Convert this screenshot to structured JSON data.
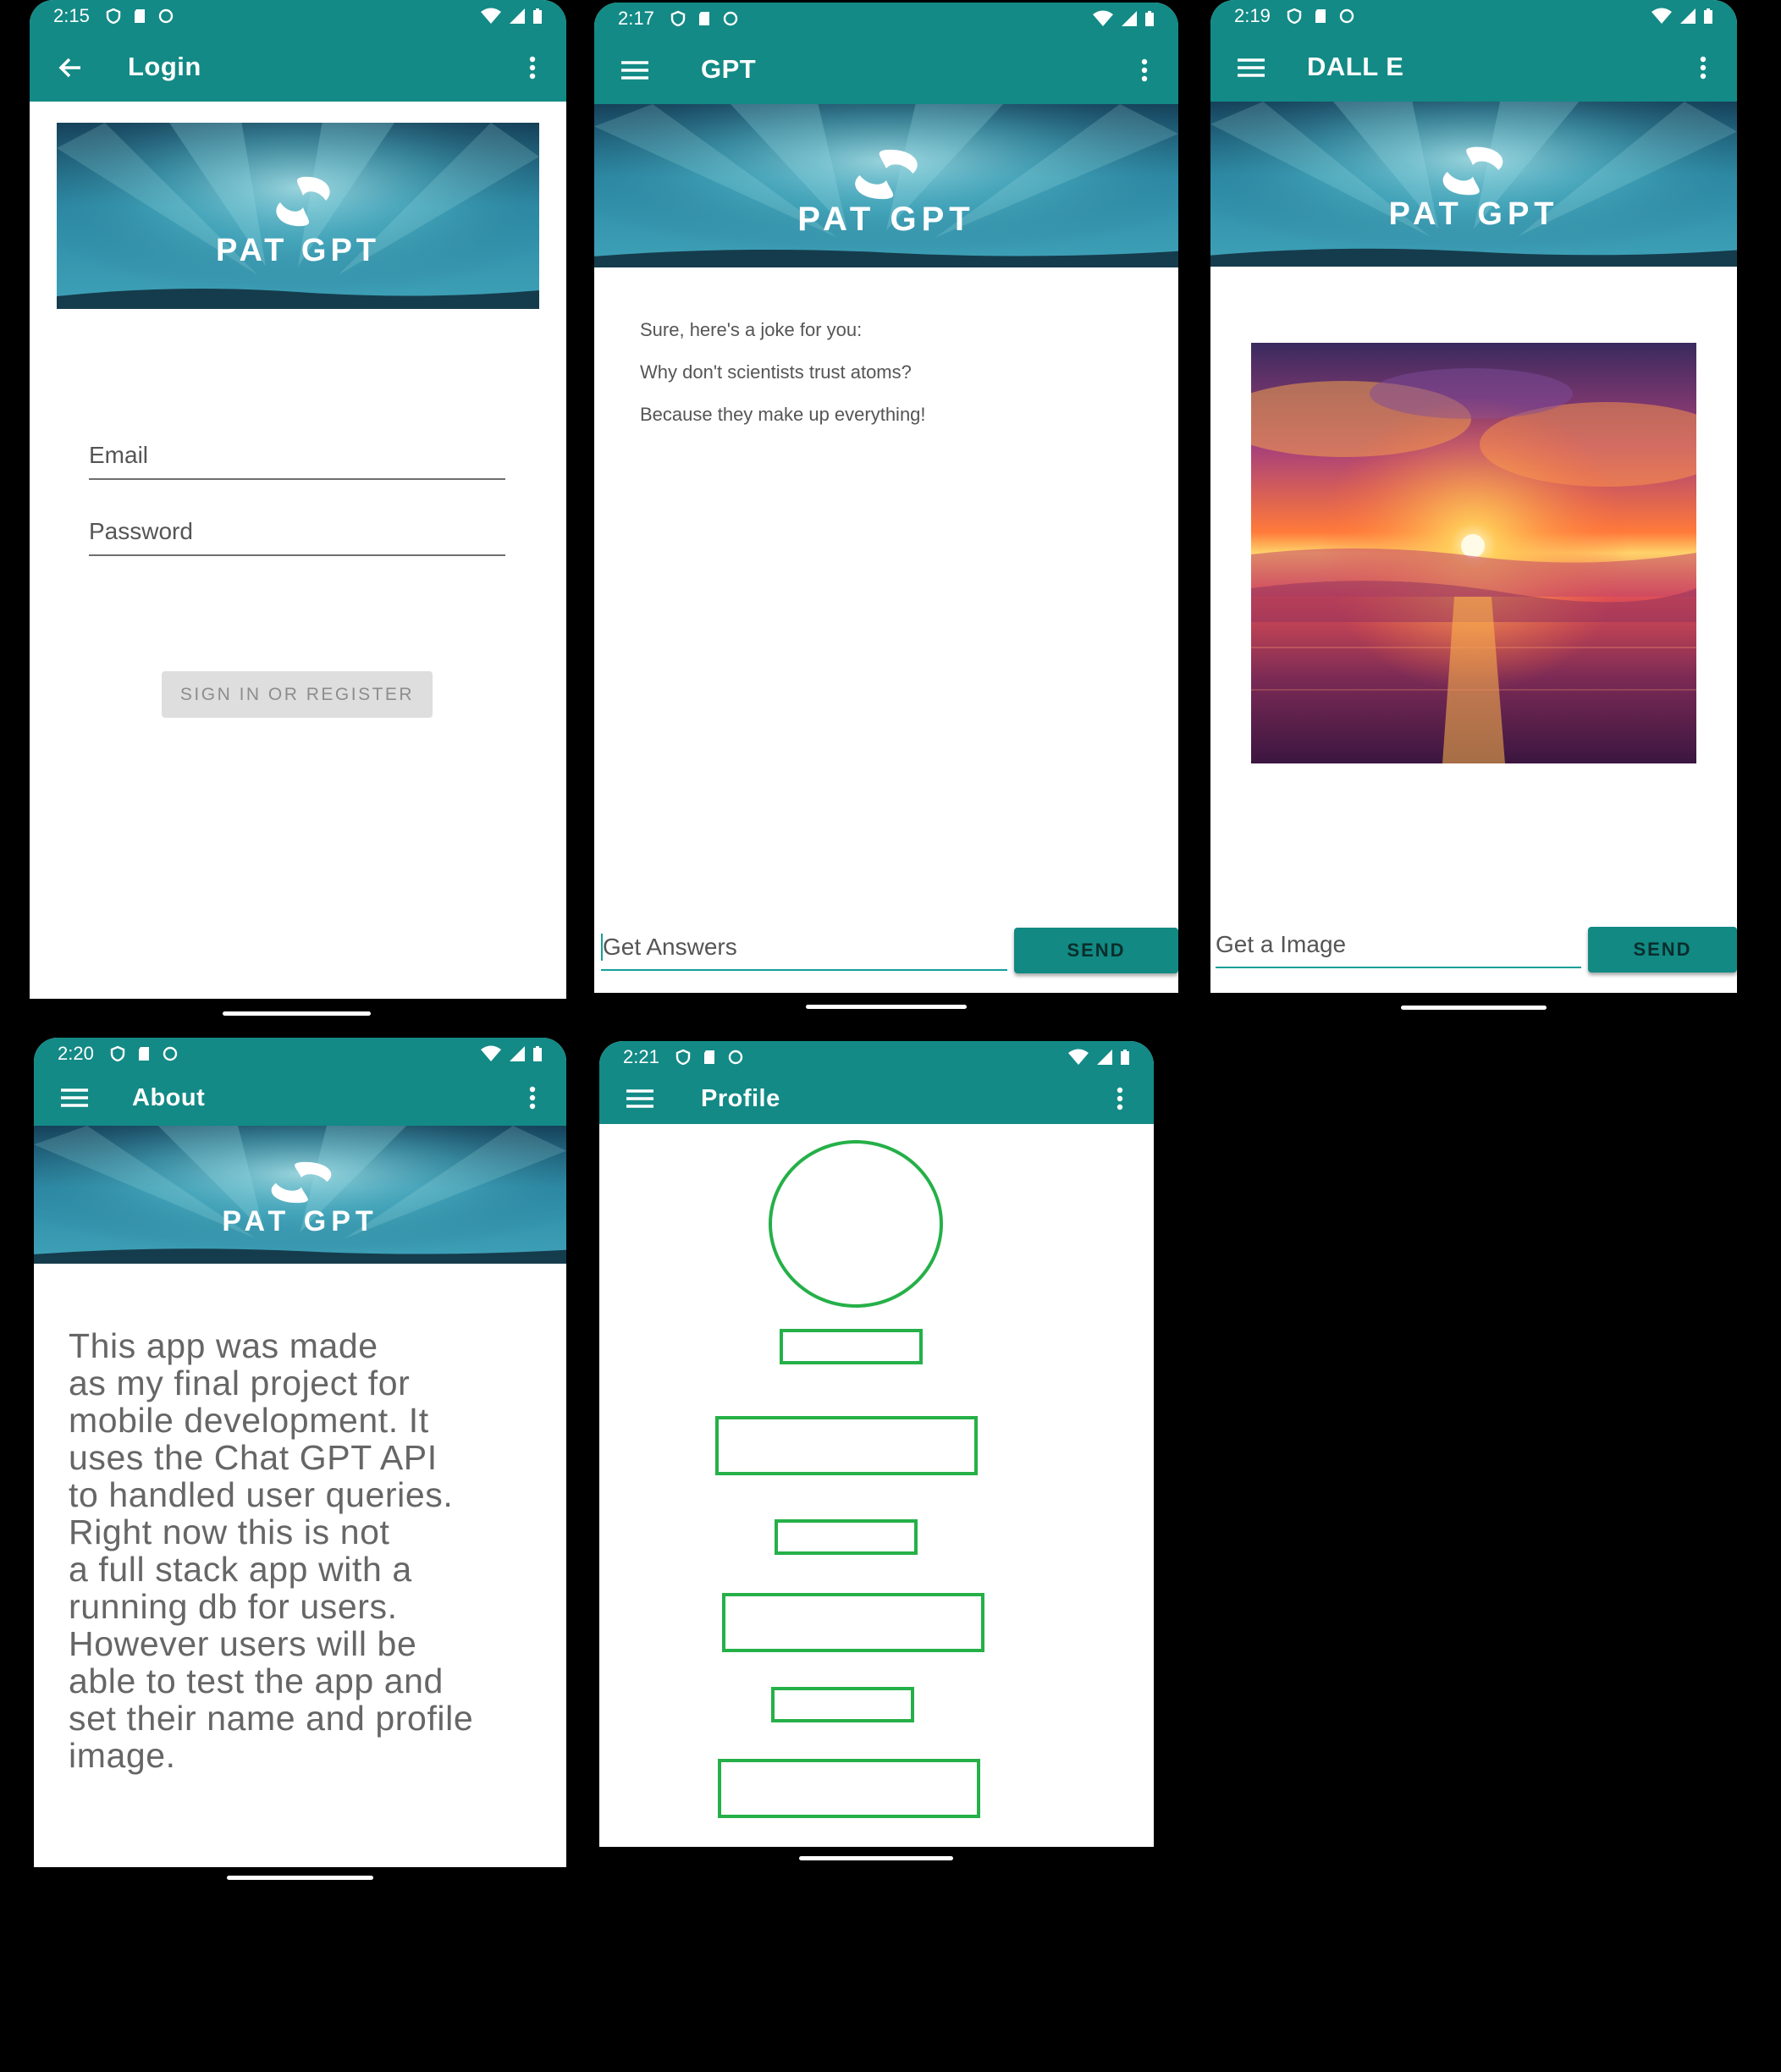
{
  "brand": {
    "logo_text": "PAT GPT",
    "primary_color": "#138a86",
    "accent_green": "#25b048"
  },
  "screens": {
    "login": {
      "status_time": "2:15",
      "title": "Login",
      "email_placeholder": "Email",
      "password_placeholder": "Password",
      "sign_in_label": "SIGN IN OR REGISTER"
    },
    "gpt": {
      "status_time": "2:17",
      "title": "GPT",
      "messages": [
        "Sure, here's a joke for you:",
        "Why don't scientists trust atoms?",
        "Because they make up everything!"
      ],
      "input_placeholder": "Get Answers",
      "send_label": "SEND"
    },
    "dalle": {
      "status_time": "2:19",
      "title": "DALL E",
      "image_subject": "sunset-over-water",
      "input_placeholder": "Get a Image",
      "send_label": "SEND"
    },
    "about": {
      "status_time": "2:20",
      "title": "About",
      "body_lines": [
        "This app was made",
        "as my final project for",
        "mobile development. It",
        "uses the Chat GPT API",
        "to handled user queries.",
        "Right now this is not",
        "a full stack app with a",
        "running db for users.",
        "However users will be",
        "able to test the app and",
        "set their name and profile",
        "image."
      ]
    },
    "profile": {
      "status_time": "2:21",
      "title": "Profile"
    }
  },
  "icons": {
    "back": "arrow-left-icon",
    "menu": "hamburger-menu-icon",
    "overflow": "more-vert-icon"
  }
}
